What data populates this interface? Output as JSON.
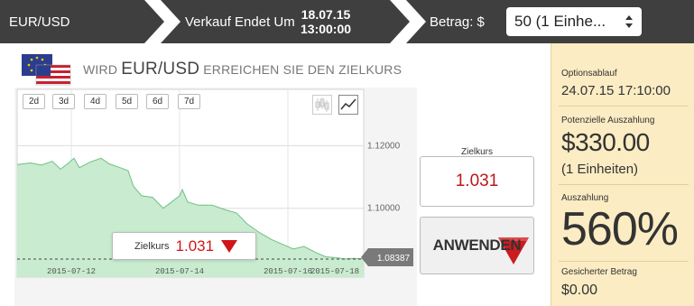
{
  "topbar": {
    "asset": "EUR/USD",
    "sale_label": "Verkauf Endet Um",
    "sale_date": "18.07.15",
    "sale_time": "13:00:00",
    "amount_label": "Betrag: $",
    "amount_value": "50 (1 Einhe..."
  },
  "question": {
    "prefix": "WIRD",
    "pair": "EUR/USD",
    "suffix": "ERREICHEN SIE DEN ZIELKURS"
  },
  "chart": {
    "periods": [
      "2d",
      "3d",
      "4d",
      "5d",
      "6d",
      "7d"
    ],
    "chart_types": [
      "candlestick-icon",
      "line-chart-icon"
    ],
    "strike_label": "Zielkurs",
    "strike_value": "1.031",
    "current_price": "1.08387"
  },
  "chart_data": {
    "type": "area",
    "x_ticks": [
      "2015-07-12",
      "2015-07-14",
      "2015-07-16",
      "2015-07-18"
    ],
    "y_ticks": [
      1.12,
      1.1
    ],
    "y_tick_labels": [
      "1.12000",
      "1.10000"
    ],
    "ylim": [
      1.078,
      1.138
    ],
    "xlim_days": [
      0,
      6.4
    ],
    "series": [
      {
        "values": [
          [
            0.0,
            1.114
          ],
          [
            0.25,
            1.1145
          ],
          [
            0.45,
            1.1138
          ],
          [
            0.65,
            1.115
          ],
          [
            0.8,
            1.1125
          ],
          [
            0.95,
            1.1145
          ],
          [
            1.05,
            1.116
          ],
          [
            1.15,
            1.113
          ],
          [
            1.35,
            1.1148
          ],
          [
            1.55,
            1.116
          ],
          [
            1.7,
            1.1142
          ],
          [
            1.9,
            1.113
          ],
          [
            2.05,
            1.112
          ],
          [
            2.15,
            1.107
          ],
          [
            2.3,
            1.104
          ],
          [
            2.5,
            1.1035
          ],
          [
            2.7,
            1.1
          ],
          [
            2.85,
            1.102
          ],
          [
            3.0,
            1.104
          ],
          [
            3.05,
            1.106
          ],
          [
            3.15,
            1.102
          ],
          [
            3.35,
            1.101
          ],
          [
            3.6,
            1.101
          ],
          [
            3.85,
            1.0995
          ],
          [
            4.05,
            1.0985
          ],
          [
            4.25,
            1.095
          ],
          [
            4.45,
            1.0925
          ],
          [
            4.7,
            1.09
          ],
          [
            4.9,
            1.0885
          ],
          [
            5.1,
            1.087
          ],
          [
            5.3,
            1.0878
          ],
          [
            5.5,
            1.086
          ],
          [
            5.7,
            1.0845
          ],
          [
            5.9,
            1.0842
          ],
          [
            6.05,
            1.0838
          ],
          [
            6.2,
            1.084
          ],
          [
            6.4,
            1.08387
          ]
        ]
      }
    ],
    "grid": true,
    "colors": {
      "fill": "#c9ebcf",
      "line": "#6fc085"
    }
  },
  "trade": {
    "target_label": "Zielkurs",
    "target_value": "1.031",
    "apply_label": "ANWENDEN"
  },
  "panel": {
    "expiry_label": "Optionsablauf",
    "expiry_value": "24.07.15 17:10:00",
    "payout_label": "Potenzielle Auszahlung",
    "payout_value": "$330.00",
    "payout_units": "(1 Einheiten)",
    "percent_label": "Auszahlung",
    "percent_value": "560%",
    "secured_label": "Gesicherter Betrag",
    "secured_value": "$0.00"
  },
  "colors": {
    "topbar": "#3f3f3f",
    "panel": "#fbecc3",
    "strike_red": "#d0161a",
    "area_fill": "#c9ebcf",
    "area_line": "#6fc085"
  }
}
